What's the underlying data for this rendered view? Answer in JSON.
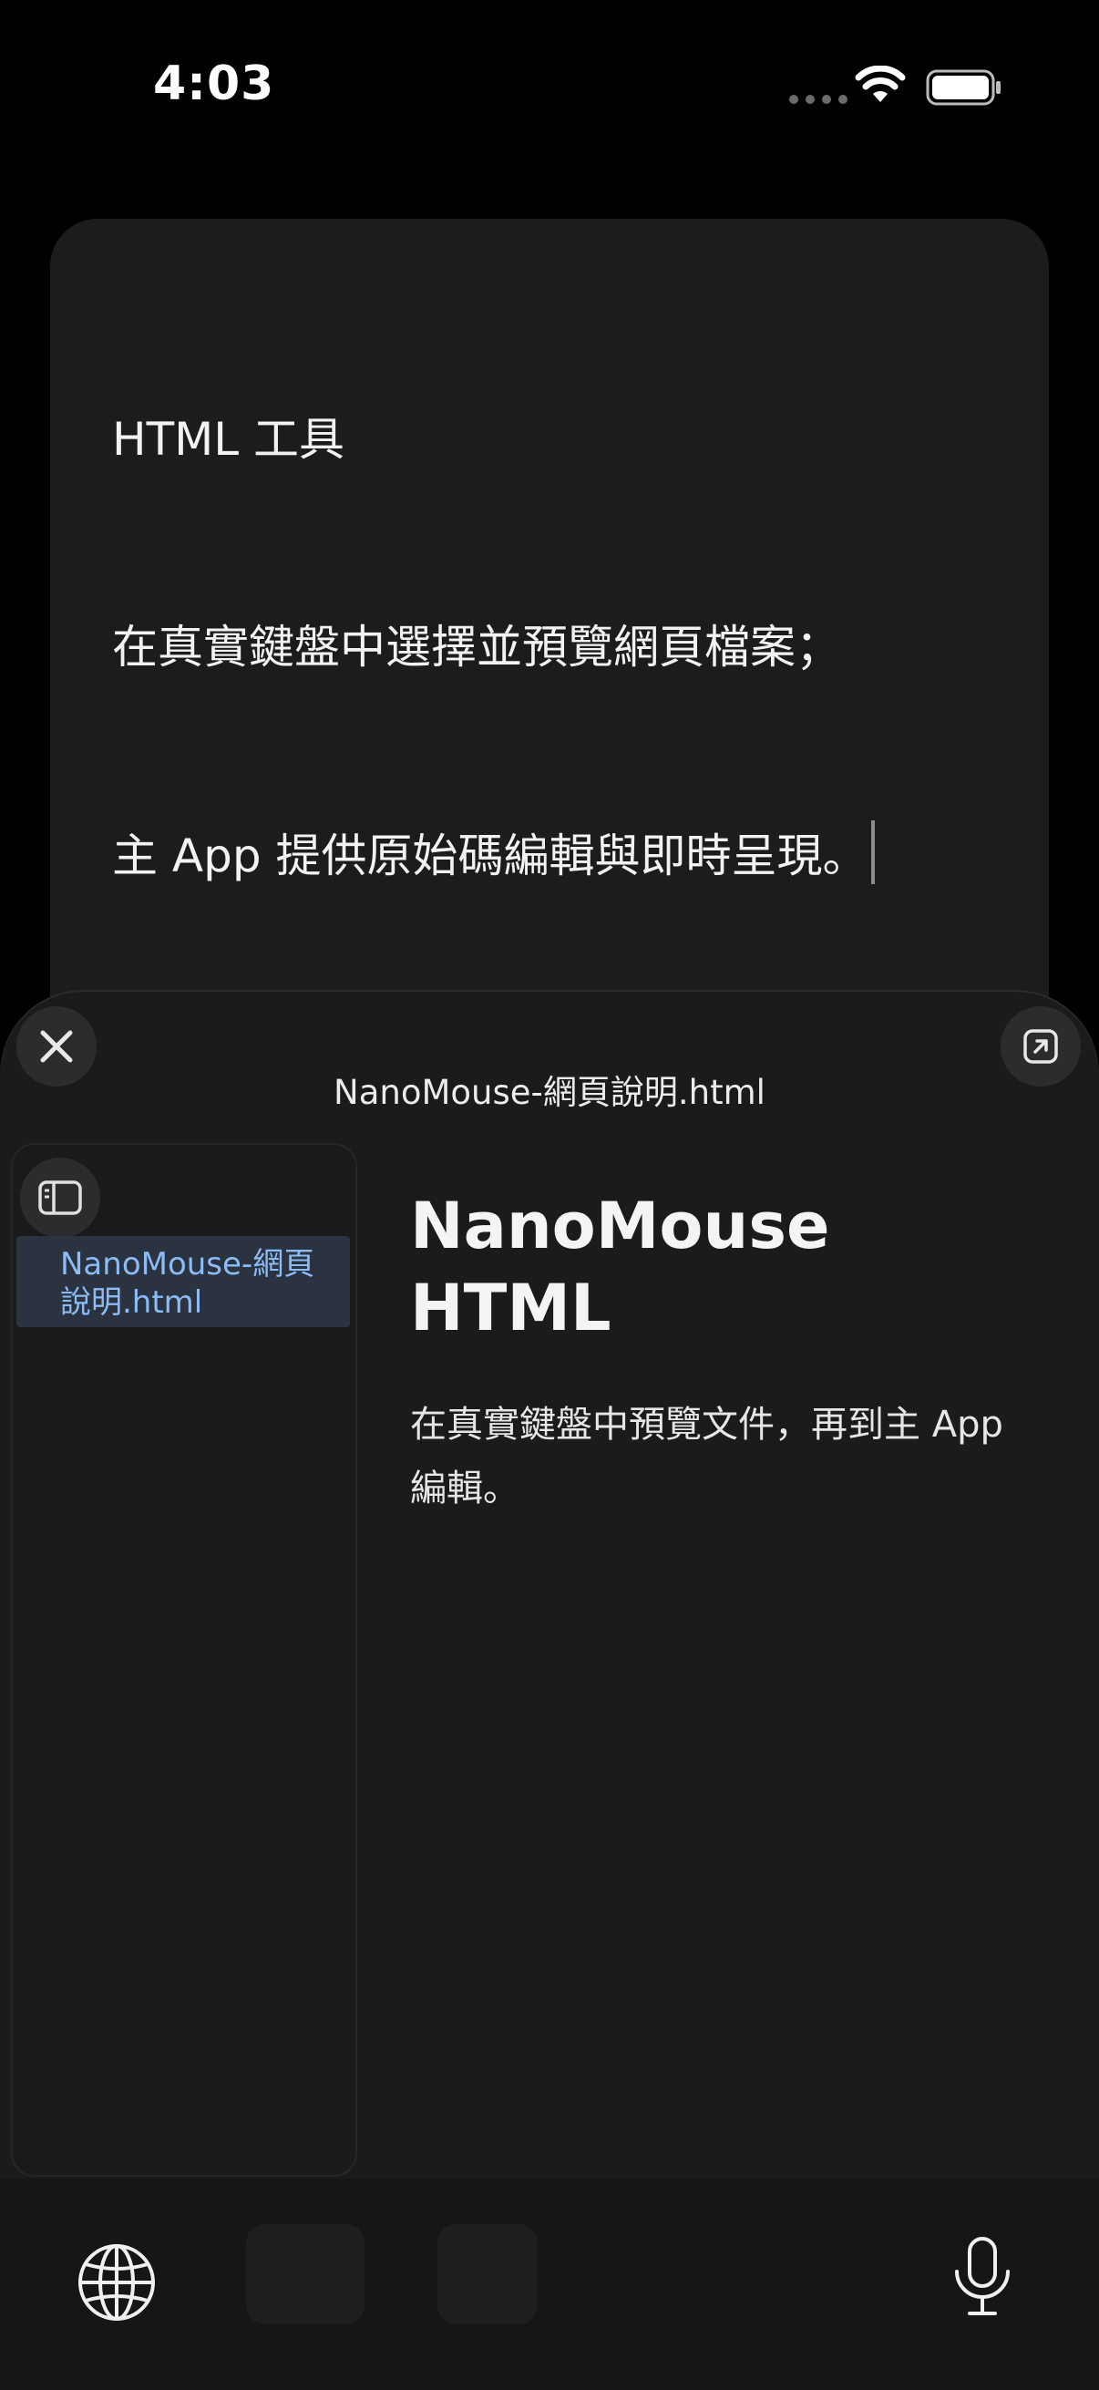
{
  "status_bar": {
    "time": "4:03",
    "icons": [
      "signal-dots-icon",
      "wifi-icon",
      "battery-icon"
    ]
  },
  "note": {
    "lines": [
      "HTML 工具",
      "在真實鍵盤中選擇並預覽網頁檔案；",
      "主 App 提供原始碼編輯與即時呈現。"
    ]
  },
  "sheet": {
    "title": "NanoMouse-網頁說明.html",
    "close_icon": "close-icon",
    "open_icon": "open-external-icon"
  },
  "sidebar": {
    "toggle_icon": "sidebar-icon",
    "files": [
      {
        "label": "NanoMouse-網頁說明.html",
        "selected": true
      }
    ]
  },
  "preview": {
    "heading": "NanoMouse HTML",
    "body": "在真實鍵盤中預覽文件，再到主 App 編輯。"
  },
  "keyboard": {
    "icons": [
      "globe-icon",
      "microphone-icon"
    ]
  },
  "colors": {
    "background": "#000000",
    "card": "#1c1c1e",
    "sheet": "#1b1b1c",
    "selection": "#2b3240",
    "link": "#8bbcf5"
  }
}
